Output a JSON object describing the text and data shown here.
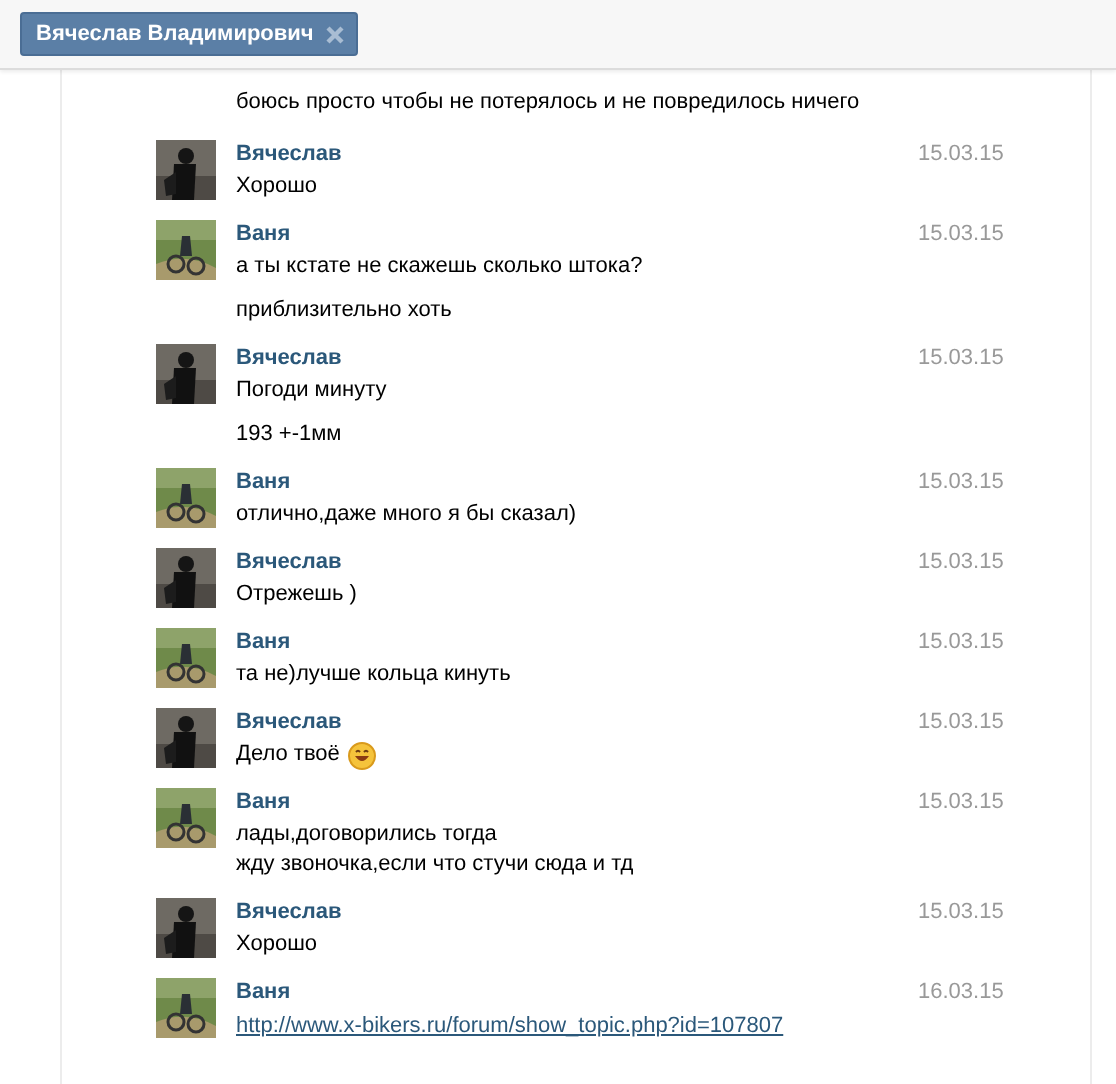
{
  "tab": {
    "title": "Вячеслав Владимирович",
    "closable": true
  },
  "continued_text": "боюсь просто чтобы не потерялось и не повредилось ничего",
  "messages": [
    {
      "author": "Вячеслав",
      "kind": "dark",
      "date": "15.03.15",
      "blocks": [
        [
          {
            "kind": "text",
            "text": "Хорошо"
          }
        ]
      ]
    },
    {
      "author": "Ваня",
      "kind": "green",
      "date": "15.03.15",
      "blocks": [
        [
          {
            "kind": "text",
            "text": "а ты кстате не скажешь сколько штока?"
          }
        ],
        [
          {
            "kind": "text",
            "text": "приблизительно хоть"
          }
        ]
      ]
    },
    {
      "author": "Вячеслав",
      "kind": "dark",
      "date": "15.03.15",
      "blocks": [
        [
          {
            "kind": "text",
            "text": "Погоди минуту"
          }
        ],
        [
          {
            "kind": "text",
            "text": "193 +-1мм"
          }
        ]
      ]
    },
    {
      "author": "Ваня",
      "kind": "green",
      "date": "15.03.15",
      "blocks": [
        [
          {
            "kind": "text",
            "text": "отлично,даже много я бы сказал)"
          }
        ]
      ]
    },
    {
      "author": "Вячеслав",
      "kind": "dark",
      "date": "15.03.15",
      "blocks": [
        [
          {
            "kind": "text",
            "text": "Отрежешь )"
          }
        ]
      ]
    },
    {
      "author": "Ваня",
      "kind": "green",
      "date": "15.03.15",
      "blocks": [
        [
          {
            "kind": "text",
            "text": "та не)лучше кольца кинуть"
          }
        ]
      ]
    },
    {
      "author": "Вячеслав",
      "kind": "dark",
      "date": "15.03.15",
      "blocks": [
        [
          {
            "kind": "smile",
            "text": "Дело твоё"
          }
        ]
      ]
    },
    {
      "author": "Ваня",
      "kind": "green",
      "date": "15.03.15",
      "blocks": [
        [
          {
            "kind": "text",
            "text": "лады,договорились тогда"
          },
          {
            "kind": "text",
            "text": "жду звоночка,если что стучи сюда и тд"
          }
        ]
      ]
    },
    {
      "author": "Вячеслав",
      "kind": "dark",
      "date": "15.03.15",
      "blocks": [
        [
          {
            "kind": "text",
            "text": "Хорошо"
          }
        ]
      ]
    },
    {
      "author": "Ваня",
      "kind": "green",
      "date": "16.03.15",
      "blocks": [
        [
          {
            "kind": "link",
            "text": "http://www.x-bikers.ru/forum/show_topic.php?id=107807"
          }
        ]
      ]
    }
  ]
}
